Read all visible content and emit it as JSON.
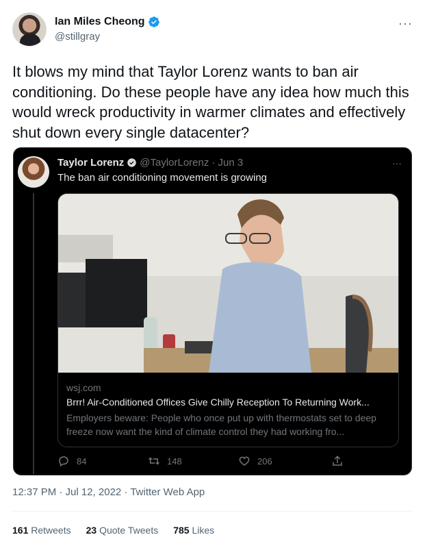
{
  "author": {
    "name": "Ian Miles Cheong",
    "handle": "@stillgray"
  },
  "tweet": {
    "text": "It blows my mind that Taylor Lorenz wants to ban air conditioning. Do these people have any idea how much this would wreck productivity in warmer climates and effectively shut down every single datacenter?"
  },
  "quoted": {
    "name": "Taylor Lorenz",
    "handle": "@TaylorLorenz",
    "date": "· Jun 3",
    "text": "The ban air conditioning movement is growing",
    "card": {
      "domain": "wsj.com",
      "title": "Brrr! Air-Conditioned Offices Give Chilly Reception To Returning Work...",
      "description": "Employers beware: People who once put up with thermostats set to deep freeze now want the kind of climate control they had working fro..."
    },
    "actions": {
      "replies": "84",
      "retweets": "148",
      "likes": "206"
    }
  },
  "meta": {
    "timestamp": "12:37 PM · Jul 12, 2022 · Twitter Web App"
  },
  "stats": {
    "retweets_count": "161",
    "retweets_label": "Retweets",
    "quotes_count": "23",
    "quotes_label": "Quote Tweets",
    "likes_count": "785",
    "likes_label": "Likes"
  },
  "colors": {
    "verified": "#1d9bf0",
    "text": "#0f1419",
    "secondary": "#536471"
  },
  "icons": {
    "verified": "verified-badge-icon",
    "more": "more-dots-icon",
    "reply": "reply-icon",
    "retweet": "retweet-icon",
    "like": "heart-icon",
    "share": "share-icon"
  }
}
